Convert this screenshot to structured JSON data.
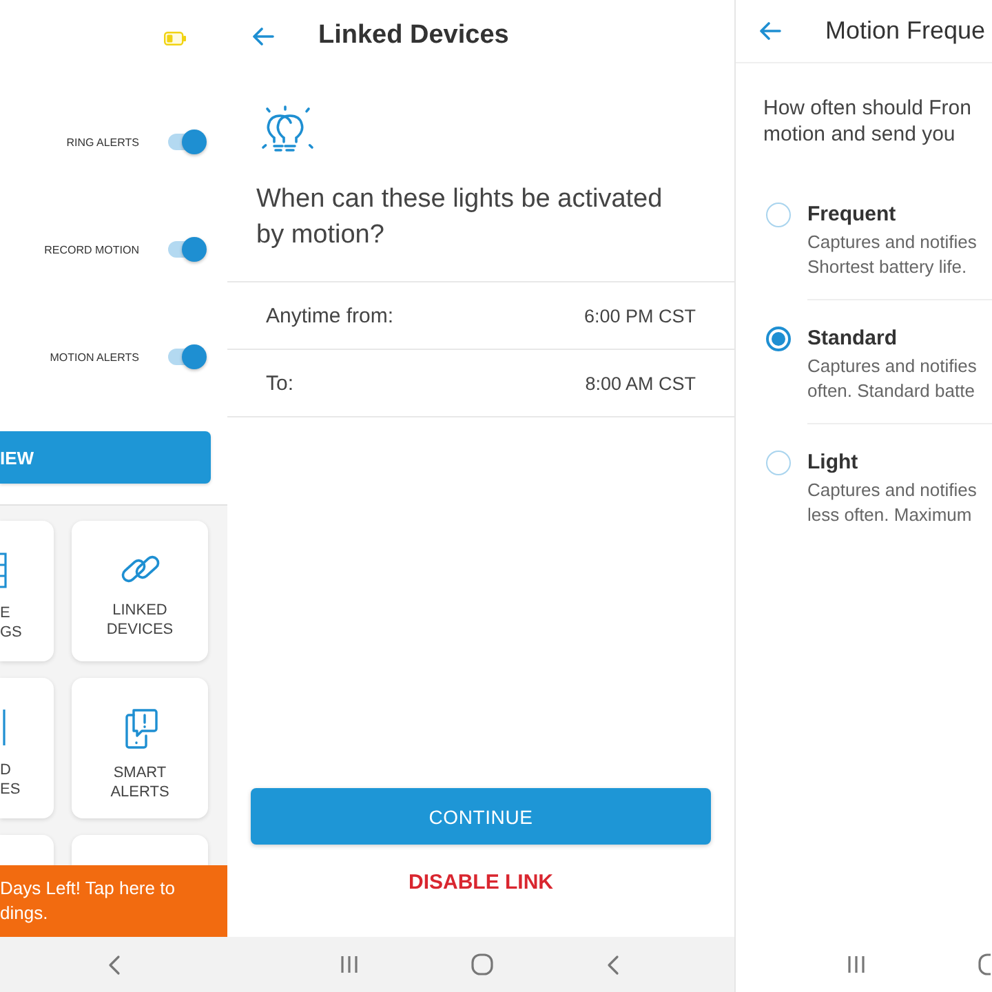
{
  "settings_screen": {
    "toggles": [
      {
        "label": "RING ALERTS",
        "on": true
      },
      {
        "label": "RECORD MOTION",
        "on": true
      },
      {
        "label": "MOTION ALERTS",
        "on": true
      }
    ],
    "wide_button": {
      "label": "IEW"
    },
    "tiles": [
      {
        "label_lines": [
          "E",
          "GS"
        ]
      },
      {
        "label_lines": [
          "LINKED",
          "DEVICES"
        ]
      },
      {
        "label_lines": [
          "D",
          "ES"
        ]
      },
      {
        "label_lines": [
          "SMART",
          "ALERTS"
        ]
      }
    ],
    "banner": {
      "lines": [
        "Days Left! Tap here to",
        "dings."
      ]
    }
  },
  "linked_devices_screen": {
    "title": "Linked Devices",
    "question": "When can these lights be activated by motion?",
    "schedule": [
      {
        "label": "Anytime from:",
        "value": "6:00 PM CST"
      },
      {
        "label": "To:",
        "value": "8:00 AM CST"
      }
    ],
    "primary_button": {
      "label": "CONTINUE"
    },
    "danger_link": {
      "label": "DISABLE LINK"
    }
  },
  "motion_frequency_screen": {
    "title": "Motion Freque",
    "prompt_lines": [
      "How often should Fron",
      "motion and send you"
    ],
    "options": [
      {
        "title": "Frequent",
        "description_lines": [
          "Captures and notifies",
          "Shortest battery life."
        ],
        "selected": false
      },
      {
        "title": "Standard",
        "description_lines": [
          "Captures and notifies",
          "often. Standard batte"
        ],
        "selected": true
      },
      {
        "title": "Light",
        "description_lines": [
          "Captures and notifies",
          "less often. Maximum"
        ],
        "selected": false
      }
    ]
  }
}
